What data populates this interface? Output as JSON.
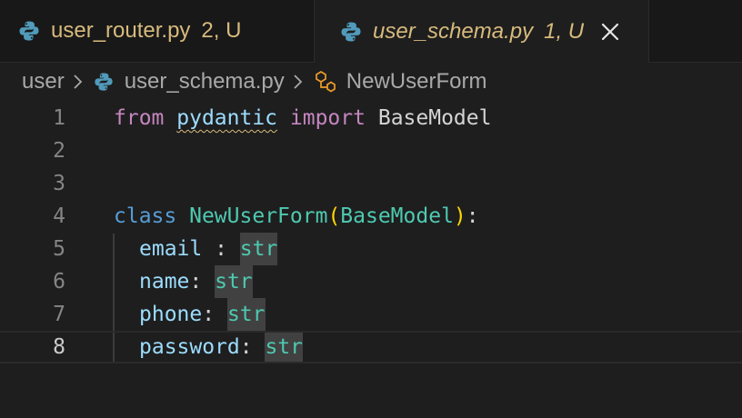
{
  "tabs": [
    {
      "filename": "user_router.py",
      "status": "2, U",
      "icon": "python-icon",
      "active": false
    },
    {
      "filename": "user_schema.py",
      "status": "1, U",
      "icon": "python-icon",
      "active": true
    }
  ],
  "breadcrumb": {
    "folder": "user",
    "file": "user_schema.py",
    "symbol": "NewUserForm",
    "icons": [
      "chevron-right-icon",
      "python-icon",
      "symbol-class-icon"
    ]
  },
  "editor": {
    "current_line": 8,
    "line_numbers": [
      "1",
      "2",
      "3",
      "4",
      "5",
      "6",
      "7",
      "8"
    ],
    "line1": {
      "kw_from": "from",
      "module": "pydantic",
      "kw_import": "import",
      "name": "BaseModel"
    },
    "line4": {
      "kw_class": "class",
      "class_name": "NewUserForm",
      "open_paren": "(",
      "base": "BaseModel",
      "close_paren": ")",
      "colon": ":"
    },
    "fields": [
      {
        "name": "email",
        "sep": " : ",
        "type": "str"
      },
      {
        "name": "name",
        "sep": ": ",
        "type": "str"
      },
      {
        "name": "phone",
        "sep": ": ",
        "type": "str"
      },
      {
        "name": "password",
        "sep": ": ",
        "type": "str"
      }
    ]
  },
  "colors": {
    "background": "#1e1e1e",
    "tab_text_modified": "#d7ba7d",
    "keyword_import": "#c586c0",
    "keyword_class": "#569cd6",
    "class_name": "#4ec9b0",
    "variable": "#9cdcfe",
    "bracket": "#ffd700",
    "python_icon": "#519aba"
  }
}
